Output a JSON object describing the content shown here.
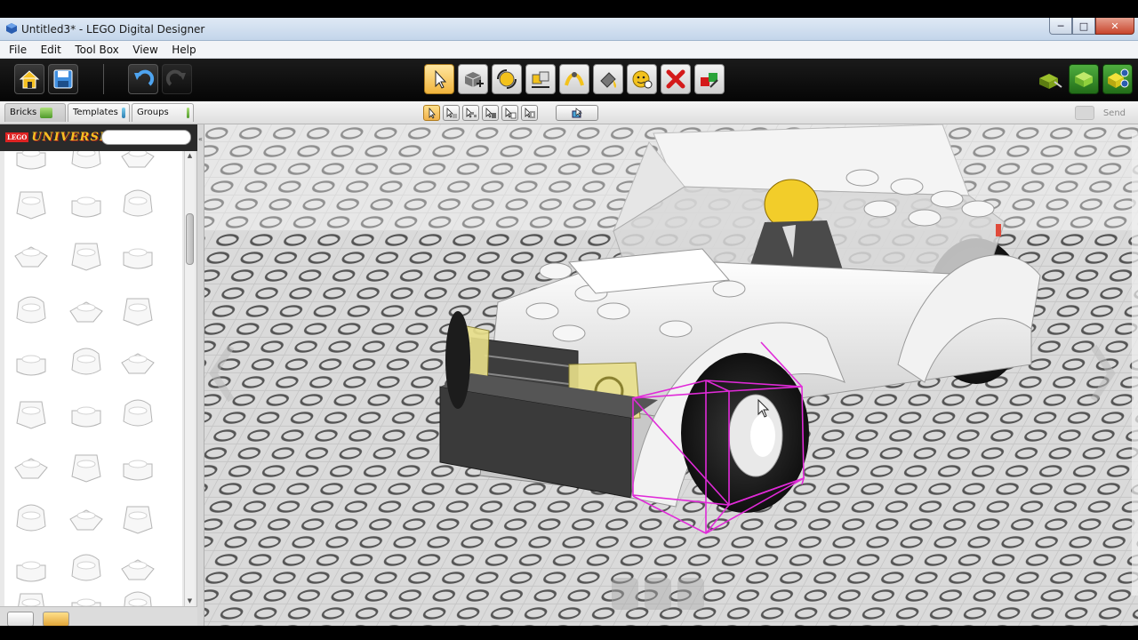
{
  "window": {
    "title": "Untitled3* - LEGO Digital Designer",
    "minimize": "─",
    "maximize": "□",
    "close": "✕"
  },
  "menu": [
    "File",
    "Edit",
    "Tool Box",
    "View",
    "Help"
  ],
  "toolbar": {
    "left_tools": [
      "home-icon",
      "save-icon",
      "undo-icon",
      "redo-icon"
    ],
    "center_tools": [
      "select-tool-icon",
      "clone-tool-icon",
      "hinge-tool-icon",
      "hinge-align-icon",
      "flex-tool-icon",
      "paint-tool-icon",
      "hide-tool-icon",
      "delete-tool-icon",
      "colour-picker-icon"
    ],
    "active_tool": "select-tool-icon",
    "right_tools": [
      "build-mode-icon",
      "view-mode-icon",
      "building-guide-icon"
    ]
  },
  "subtoolbar": {
    "selection_modes": [
      "single-select-icon",
      "multi-select-icon",
      "connected-select-icon",
      "same-colour-select-icon",
      "same-shape-select-icon",
      "invert-select-icon"
    ],
    "active_mode": "single-select-icon",
    "extra_tool": "group-brick-icon",
    "send_label": "Send"
  },
  "left_panel": {
    "tabs": [
      {
        "label": "Bricks"
      },
      {
        "label": "Templates"
      },
      {
        "label": "Groups"
      }
    ],
    "active_tab": "Bricks",
    "logo_brand": "LEGO",
    "logo_text": "UNIVERSE",
    "search_value": ""
  },
  "colors": {
    "accent": "#f0b43c",
    "selection": "#e02ad8",
    "grid": "#bdbdbd",
    "titlebar": "#c3d5ea"
  }
}
